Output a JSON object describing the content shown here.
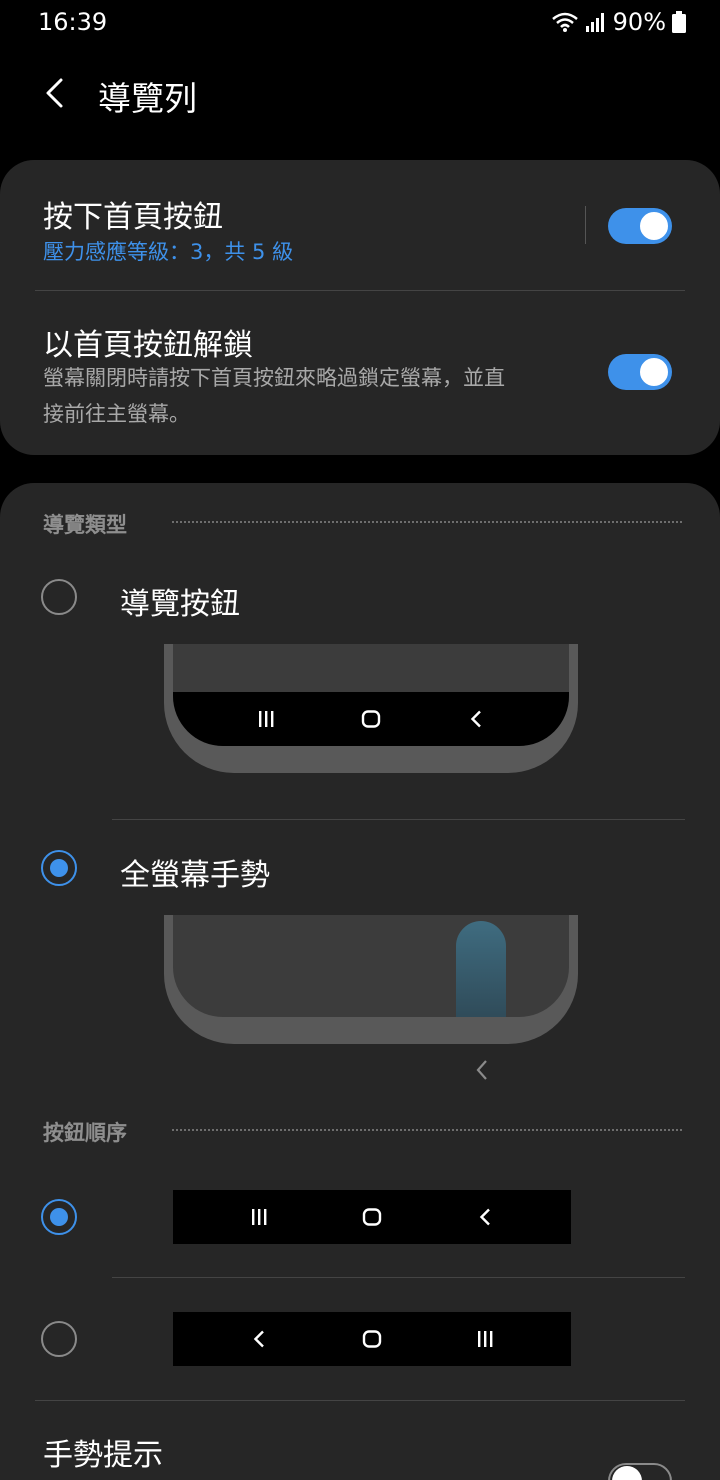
{
  "status_bar": {
    "time": "16:39",
    "battery": "90%"
  },
  "app_bar": {
    "title": "導覽列"
  },
  "home_button": {
    "title": "按下首頁按鈕",
    "subtitle": "壓力感應等級：3，共 5 級",
    "enabled": true
  },
  "unlock_home": {
    "title": "以首頁按鈕解鎖",
    "description_line1": "螢幕關閉時請按下首頁按鈕來略過鎖定螢幕，並直",
    "description_line2": "接前往主螢幕。",
    "enabled": true
  },
  "navigation_type": {
    "header": "導覽類型",
    "options": [
      {
        "label": "導覽按鈕",
        "selected": false
      },
      {
        "label": "全螢幕手勢",
        "selected": true
      }
    ]
  },
  "button_order": {
    "header": "按鈕順序",
    "options": [
      {
        "icons": [
          "recents-icon",
          "home-icon",
          "back-icon"
        ],
        "selected": true
      },
      {
        "icons": [
          "back-icon",
          "home-icon",
          "recents-icon"
        ],
        "selected": false
      }
    ]
  },
  "gesture_hints": {
    "title": "手勢提示",
    "enabled": false
  },
  "colors": {
    "accent": "#3e91ea",
    "card": "#262626",
    "background": "#000000"
  }
}
